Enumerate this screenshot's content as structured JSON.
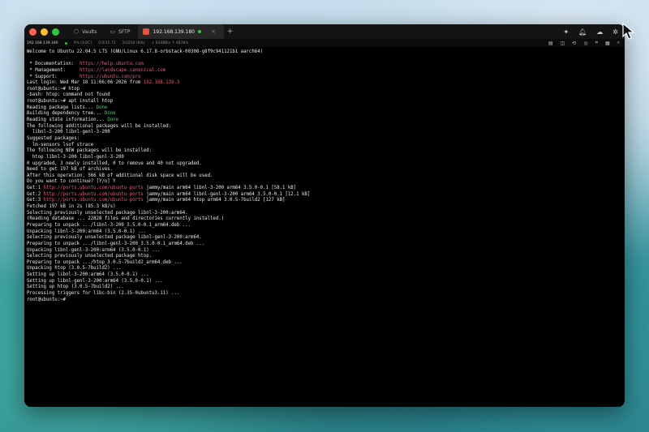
{
  "titlebar": {
    "tabs": [
      {
        "icon": "vault-icon",
        "label": "Vaults"
      },
      {
        "icon": "folder-icon",
        "label": "SFTP"
      },
      {
        "icon": "ssh-icon",
        "label": "192.168.139.180"
      }
    ],
    "new_tab": "+",
    "close_tab": "×"
  },
  "statusbar": {
    "host": "192.168.139.180",
    "cpu": "0% (1/2C)",
    "load": "0.0/15.72",
    "mem": "2/2250 (8%)",
    "net": "↓ 6338B/s ↑ 487B/s"
  },
  "terminal_lines": [
    [
      {
        "t": "Welcome to Ubuntu 22.04.5 LTS (GNU/Linux 6.17.8-orbstack-00308-g8f9c941121b1 aarch64)"
      }
    ],
    [
      {
        "t": ""
      }
    ],
    [
      {
        "t": " * Documentation:  "
      },
      {
        "t": "https://help.ubuntu.com",
        "c": "pink"
      }
    ],
    [
      {
        "t": " * Management:     "
      },
      {
        "t": "https://landscape.canonical.com",
        "c": "pink"
      }
    ],
    [
      {
        "t": " * Support:        "
      },
      {
        "t": "https://ubuntu.com/pro",
        "c": "pink"
      }
    ],
    [
      {
        "t": "Last login: Wed Mar 18 11:06:06 2026 from "
      },
      {
        "t": "192.168.139.3",
        "c": "pink"
      }
    ],
    [
      {
        "t": "root@ubuntu:~# htop"
      }
    ],
    [
      {
        "t": "-bash: htop: command not found"
      }
    ],
    [
      {
        "t": "root@ubuntu:~# apt install htop"
      }
    ],
    [
      {
        "t": "Reading package lists... "
      },
      {
        "t": "Done",
        "c": "green"
      }
    ],
    [
      {
        "t": "Building dependency tree... "
      },
      {
        "t": "Done",
        "c": "green"
      }
    ],
    [
      {
        "t": "Reading state information... "
      },
      {
        "t": "Done",
        "c": "green"
      }
    ],
    [
      {
        "t": "The following additional packages will be installed:"
      }
    ],
    [
      {
        "t": "  libnl-3-200 libnl-genl-3-200"
      }
    ],
    [
      {
        "t": "Suggested packages:"
      }
    ],
    [
      {
        "t": "  lm-sensors lsof strace"
      }
    ],
    [
      {
        "t": "The following NEW packages will be installed:"
      }
    ],
    [
      {
        "t": "  htop libnl-3-200 libnl-genl-3-200"
      }
    ],
    [
      {
        "t": "0 upgraded, 3 newly installed, 0 to remove and 40 not upgraded."
      }
    ],
    [
      {
        "t": "Need to get 197 kB of archives."
      }
    ],
    [
      {
        "t": "After this operation, 566 kB of additional disk space will be used."
      }
    ],
    [
      {
        "t": "Do you want to continue? [Y/n] Y"
      }
    ],
    [
      {
        "t": "Get:1 "
      },
      {
        "t": "http://ports.ubuntu.com/ubuntu-ports",
        "c": "pink"
      },
      {
        "t": " jammy/main arm64 libnl-3-200 arm64 3.5.0-0.1 [58.1 kB]"
      }
    ],
    [
      {
        "t": "Get:2 "
      },
      {
        "t": "http://ports.ubuntu.com/ubuntu-ports",
        "c": "pink"
      },
      {
        "t": " jammy/main arm64 libnl-genl-3-200 arm64 3.5.0-0.1 [12.1 kB]"
      }
    ],
    [
      {
        "t": "Get:3 "
      },
      {
        "t": "http://ports.ubuntu.com/ubuntu-ports",
        "c": "pink"
      },
      {
        "t": " jammy/main arm64 htop arm64 3.0.5-7build2 [127 kB]"
      }
    ],
    [
      {
        "t": "Fetched 197 kB in 2s (85.3 kB/s)"
      }
    ],
    [
      {
        "t": "Selecting previously unselected package libnl-3-200:arm64."
      }
    ],
    [
      {
        "t": "(Reading database ... 22828 files and directories currently installed.)"
      }
    ],
    [
      {
        "t": "Preparing to unpack .../libnl-3-200_3.5.0-0.1_arm64.deb ..."
      }
    ],
    [
      {
        "t": "Unpacking libnl-3-200:arm64 (3.5.0-0.1) ..."
      }
    ],
    [
      {
        "t": "Selecting previously unselected package libnl-genl-3-200:arm64."
      }
    ],
    [
      {
        "t": "Preparing to unpack .../libnl-genl-3-200_3.5.0-0.1_arm64.deb ..."
      }
    ],
    [
      {
        "t": "Unpacking libnl-genl-3-200:arm64 (3.5.0-0.1) ..."
      }
    ],
    [
      {
        "t": "Selecting previously unselected package htop."
      }
    ],
    [
      {
        "t": "Preparing to unpack .../htop_3.0.5-7build2_arm64.deb ..."
      }
    ],
    [
      {
        "t": "Unpacking htop (3.0.5-7build2) ..."
      }
    ],
    [
      {
        "t": "Setting up libnl-3-200:arm64 (3.5.0-0.1) ..."
      }
    ],
    [
      {
        "t": "Setting up libnl-genl-3-200:arm64 (3.5.0-0.1) ..."
      }
    ],
    [
      {
        "t": "Setting up htop (3.0.5-7build2) ..."
      }
    ],
    [
      {
        "t": "Processing triggers for libc-bin (2.35-0ubuntu3.11) ..."
      }
    ],
    [
      {
        "t": "root@ubuntu:~# "
      }
    ]
  ],
  "colors": {
    "pink": "#e05a7a",
    "green": "#4cc36b",
    "background": "#000000",
    "text": "#e8e8e8"
  }
}
